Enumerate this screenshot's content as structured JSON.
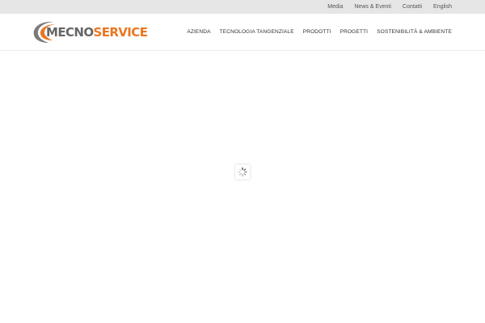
{
  "topbar": {
    "links": [
      "Media",
      "News & Eventi",
      "Contatti",
      "English"
    ]
  },
  "brand": {
    "name_part1": "MECNO",
    "name_part2": "SERVICE",
    "color_gray": "#666666",
    "color_orange": "#e87722"
  },
  "nav": {
    "items": [
      "AZIENDA",
      "TECNOLOGIA TANGENZIALE",
      "PRODOTTI",
      "PROGETTI",
      "SOSTENIBILITÀ & AMBIENTE"
    ]
  },
  "loader": {
    "icon": "spinner-icon"
  }
}
